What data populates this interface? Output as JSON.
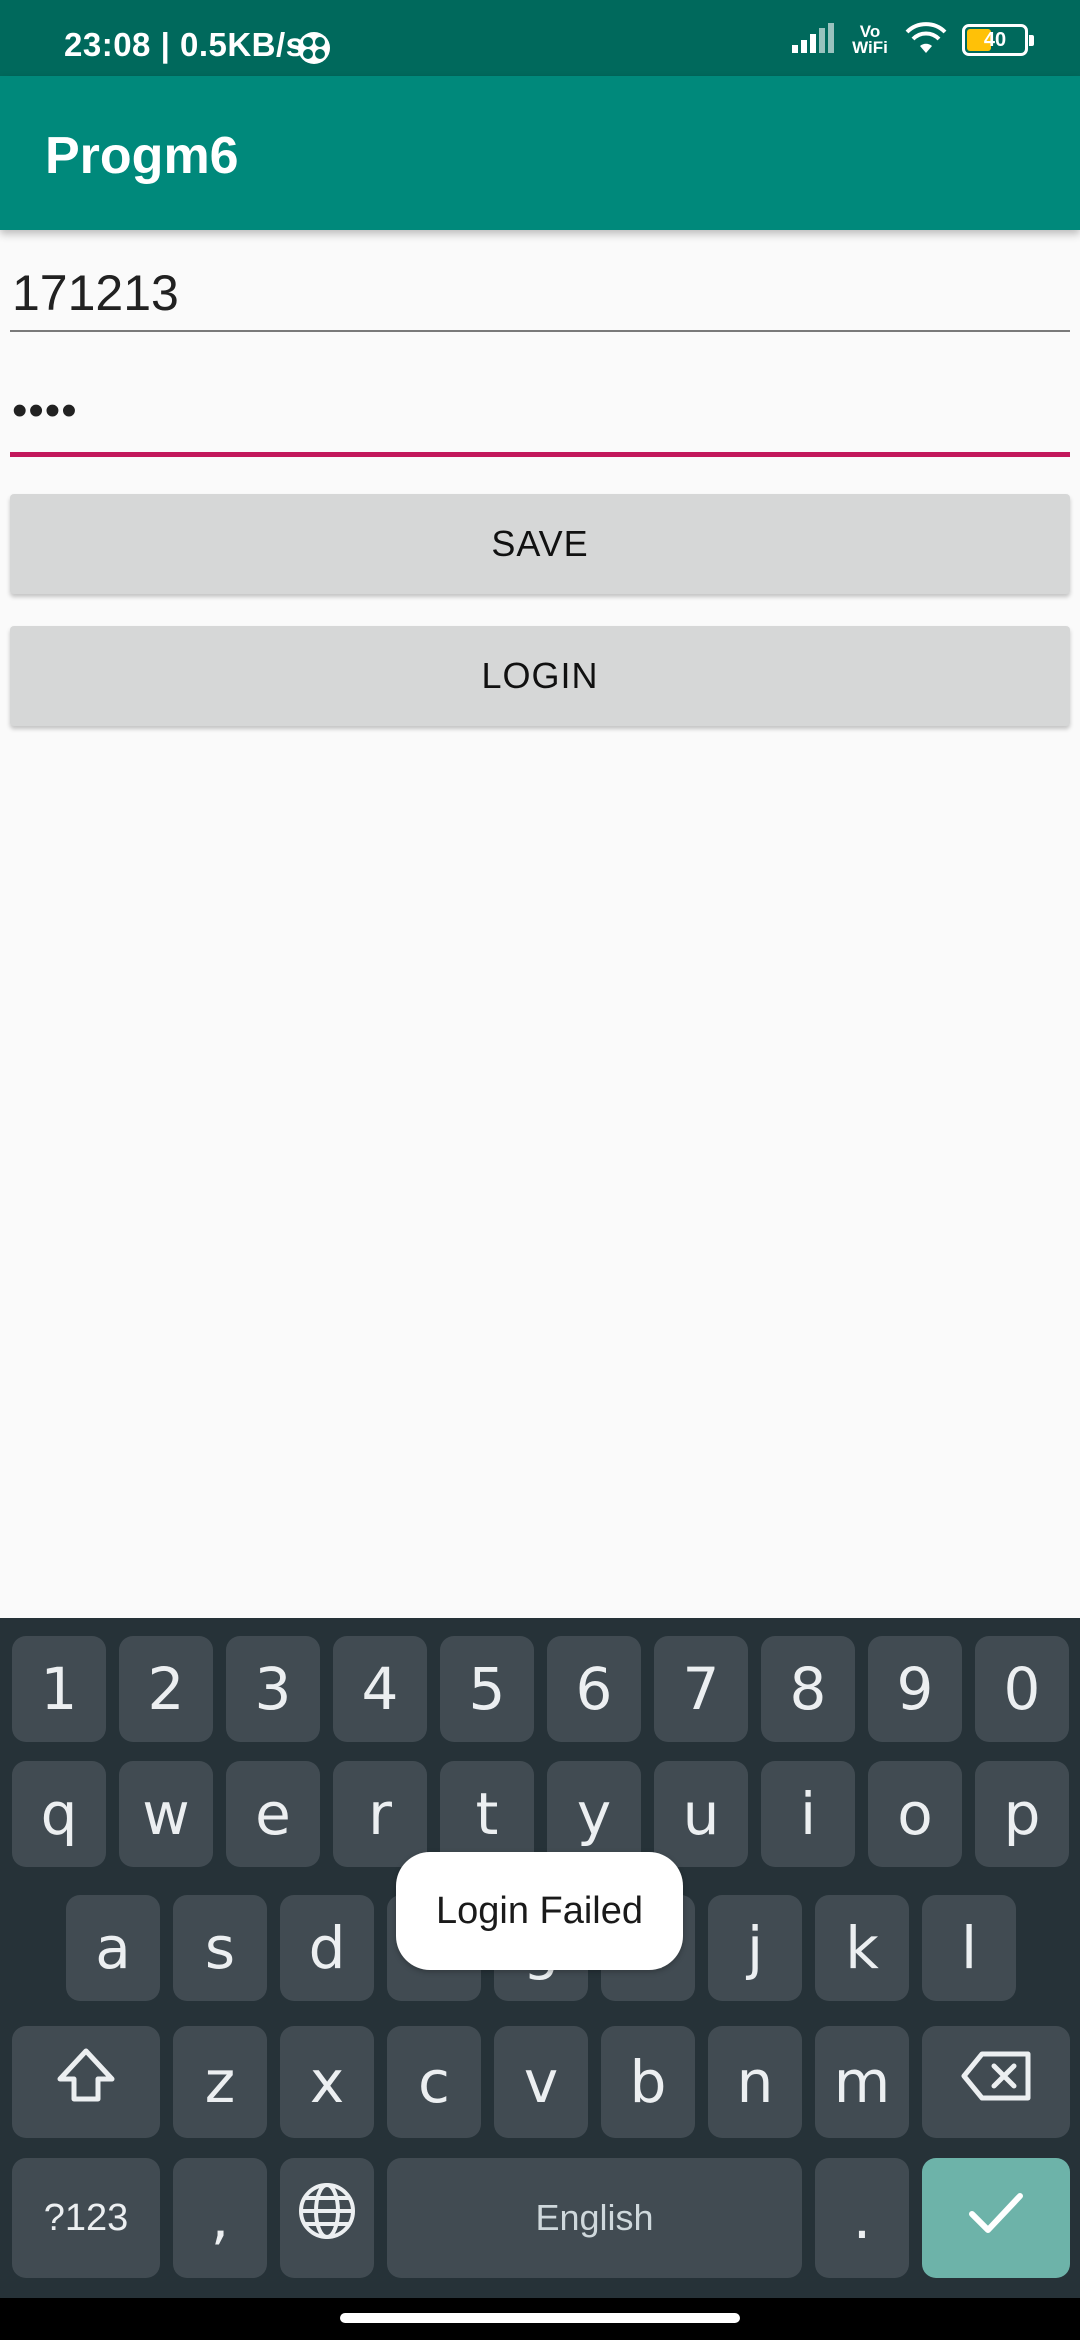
{
  "status_bar": {
    "time_and_speed": "23:08 | 0.5KB/s",
    "volte_label": "Vo WiFi",
    "battery_level": "40"
  },
  "app_bar": {
    "title": "Progm6"
  },
  "form": {
    "username_value": "171213",
    "password_masked": "••••",
    "save_label": "SAVE",
    "login_label": "LOGIN"
  },
  "toast": {
    "message": "Login Failed"
  },
  "keyboard": {
    "number_row": [
      "1",
      "2",
      "3",
      "4",
      "5",
      "6",
      "7",
      "8",
      "9",
      "0"
    ],
    "row1": [
      "q",
      "w",
      "e",
      "r",
      "t",
      "y",
      "u",
      "i",
      "o",
      "p"
    ],
    "row2": [
      "a",
      "s",
      "d",
      "f",
      "g",
      "h",
      "j",
      "k",
      "l"
    ],
    "row3": [
      "z",
      "x",
      "c",
      "v",
      "b",
      "n",
      "m"
    ],
    "symbols_label": "?123",
    "comma_label": ",",
    "space_label": "English",
    "period_label": ".",
    "icons": {
      "shift": "shift-icon",
      "backspace": "backspace-icon",
      "language": "globe-icon",
      "enter": "checkmark-icon"
    },
    "enter_color": "#6db3a9"
  },
  "colors": {
    "status_bar": "#00695c",
    "app_bar": "#00897b",
    "accent": "#c2185b",
    "keyboard_bg": "#263238",
    "key_bg": "#414b52"
  }
}
